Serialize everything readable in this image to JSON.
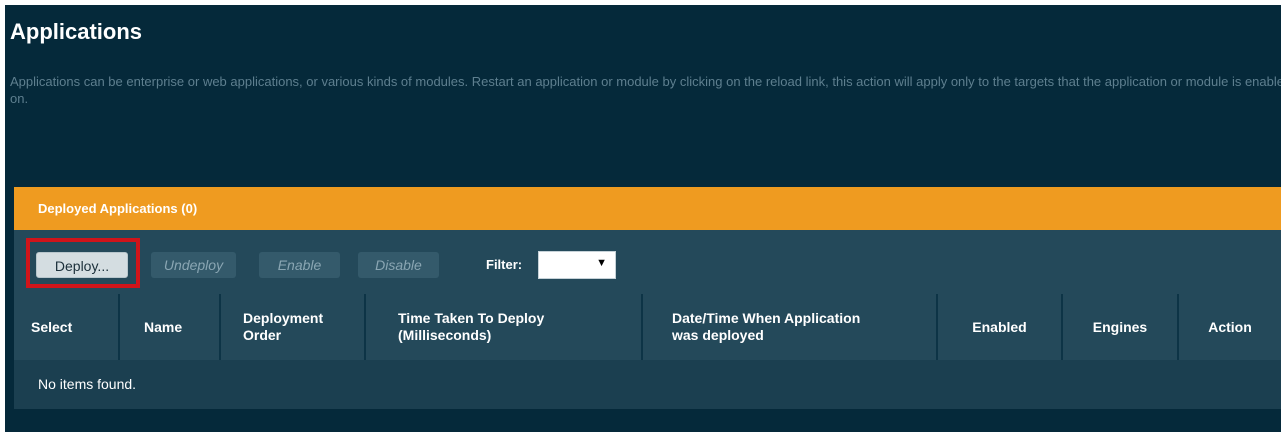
{
  "page": {
    "title": "Applications",
    "description": "Applications can be enterprise or web applications, or various kinds of modules. Restart an application or module by clicking on the reload link, this action will apply only to the targets that the application or module is enabled on."
  },
  "panel": {
    "title": "Deployed Applications (0)"
  },
  "toolbar": {
    "deploy_label": "Deploy...",
    "undeploy_label": "Undeploy",
    "enable_label": "Enable",
    "disable_label": "Disable",
    "filter_label": "Filter:",
    "filter_value": ""
  },
  "table": {
    "columns": {
      "select": "Select",
      "name": "Name",
      "deployment_order_1": "Deployment",
      "deployment_order_2": "Order",
      "time_taken_1": "Time Taken To Deploy",
      "time_taken_2": "(Milliseconds)",
      "deployed_time_1": "Date/Time When Application",
      "deployed_time_2": "was deployed",
      "enabled": "Enabled",
      "engines": "Engines",
      "action": "Action"
    },
    "empty_message": "No items found."
  },
  "colors": {
    "background": "#05293a",
    "panel_header": "#ef9b20",
    "toolbar": "#24495a",
    "highlight": "#d0141a"
  }
}
